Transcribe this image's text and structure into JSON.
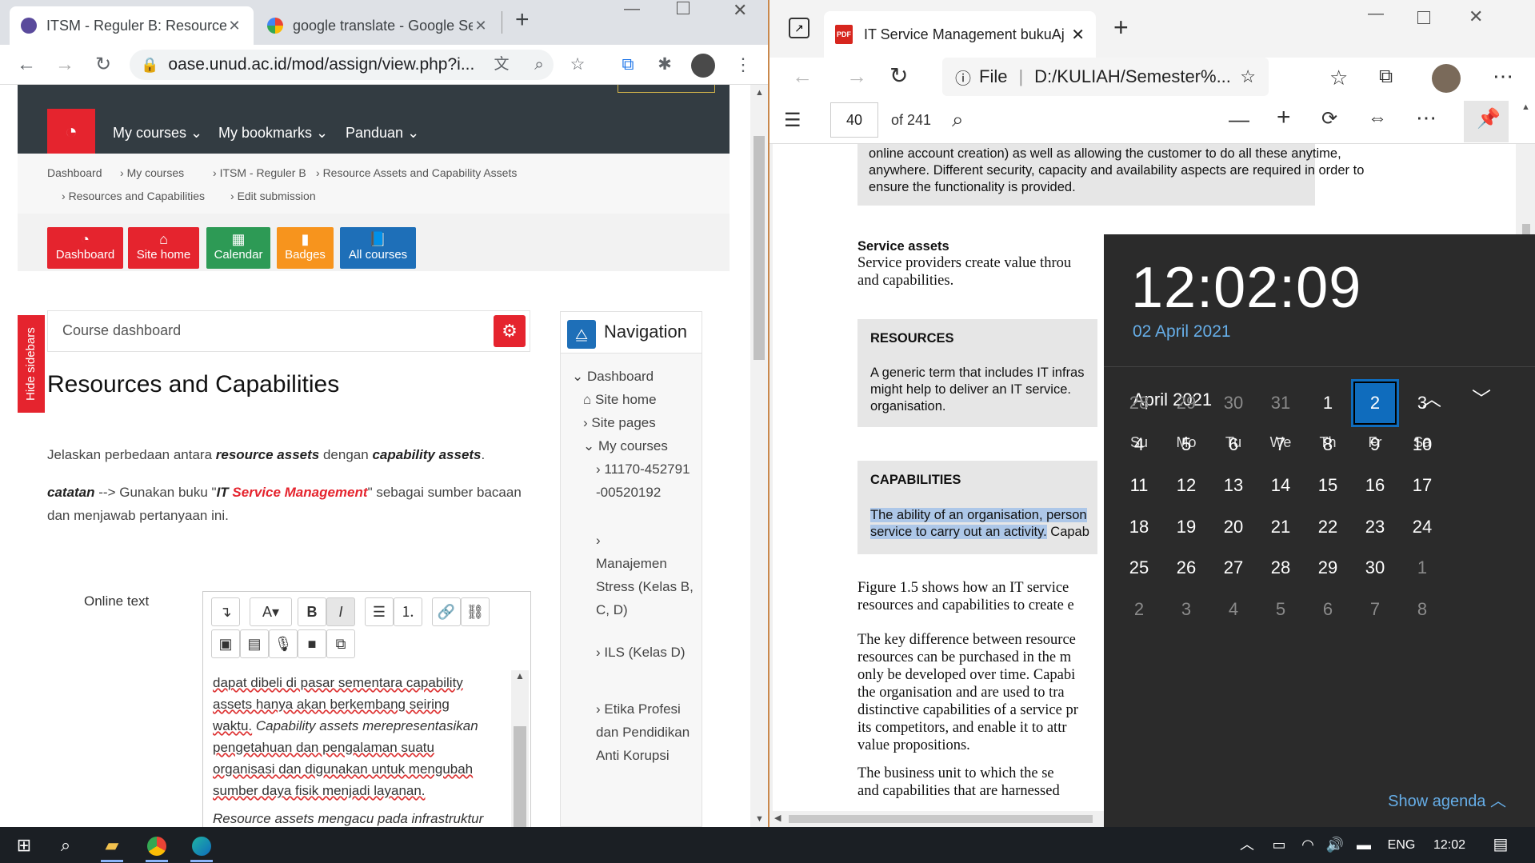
{
  "chrome": {
    "tabs": [
      {
        "title": "ITSM - Reguler B: Resources and",
        "active": true
      },
      {
        "title": "google translate - Google Searc",
        "active": false
      }
    ],
    "url": "oase.unud.ac.id/mod/assign/view.php?i...",
    "navbar": {
      "my_courses": "My courses",
      "my_bookmarks": "My bookmarks",
      "panduan": "Panduan"
    },
    "breadcrumb": [
      "Dashboard",
      "My courses",
      "ITSM - Reguler B",
      "Resource Assets and Capability Assets",
      "Resources and Capabilities",
      "Edit submission"
    ],
    "quick_buttons": [
      {
        "label": "Dashboard",
        "color": "#e5242e"
      },
      {
        "label": "Site home",
        "color": "#e5242e"
      },
      {
        "label": "Calendar",
        "color": "#2d9a55"
      },
      {
        "label": "Badges",
        "color": "#f7941d"
      },
      {
        "label": "All courses",
        "color": "#1e6fb8"
      }
    ],
    "hide_sidebars": "Hide sidebars",
    "course_dashboard": "Course dashboard",
    "page_title": "Resources and Capabilities",
    "question": {
      "p1_a": "Jelaskan perbedaan antara ",
      "p1_b": "resource assets",
      "p1_c": " dengan ",
      "p1_d": "capability assets",
      "p1_e": ".",
      "p2_a": "catatan",
      "p2_b": " --> Gunakan buku \"",
      "p2_c": "IT ",
      "p2_d": "Service Management",
      "p2_e": "\" sebagai sumber bacaan dan menjawab pertanyaan ini."
    },
    "online_text_label": "Online text",
    "editor_text": {
      "l1": "dapat dibeli di pasar sementara capability",
      "l2": "assets hanya akan berkembang seiring",
      "l3a": "waktu.",
      "l3b": " Capability assets merepresentasikan",
      "l4": "pengetahuan dan pengalaman suatu",
      "l5": "organisasi dan digunakan untuk mengubah",
      "l6": "sumber daya fisik menjadi layanan.",
      "l7": "Resource assets mengacu pada infrastruktur"
    },
    "navigation": {
      "title": "Navigation",
      "items": [
        "Dashboard",
        "Site home",
        "Site pages",
        "My courses"
      ],
      "courses": [
        "11170-452791-00520192",
        "Manajemen Stress (Kelas B, C, D)",
        "ILS (Kelas D)",
        "Etika Profesi dan Pendidikan Anti Korupsi"
      ]
    }
  },
  "edge": {
    "tab_title": "IT Service Management bukuAjar",
    "file_label": "File",
    "url": "D:/KULIAH/Semester%...",
    "pdf": {
      "page": "40",
      "of_pages": "of 241",
      "block1": [
        "online account creation) as well as allowing the customer to do all these anytime,",
        "anywhere. Different security, capacity and availability aspects are required in order to",
        "ensure the functionality is provided."
      ],
      "service_assets_heading": "Service assets",
      "service_assets_text": [
        "Service providers create value throu",
        "and capabilities."
      ],
      "resources_heading": "RESOURCES",
      "resources_text": [
        "A generic term that includes IT infras",
        "might help to deliver an IT service.",
        "organisation."
      ],
      "capabilities_heading": "CAPABILITIES",
      "capabilities_text": [
        "The ability of an organisation, person",
        "service to carry out an activity.",
        " Capab"
      ],
      "figure_text": [
        "Figure 1.5 shows how an IT service",
        "resources and capabilities to create e"
      ],
      "key_text": [
        "The key difference between resource",
        "resources can be purchased in the m",
        "only be developed over time. Capabi",
        "the organisation and are used to tra",
        "distinctive capabilities of a service pr",
        "its competitors, and enable it to attr",
        "value propositions."
      ],
      "business_text": [
        "The business unit to which the se",
        "and capabilities that are harnessed"
      ]
    }
  },
  "calendar": {
    "time": "12:02:09",
    "date": "02 April 2021",
    "month": "April 2021",
    "weekdays": [
      "Su",
      "Mo",
      "Tu",
      "We",
      "Th",
      "Fr",
      "Sa"
    ],
    "days": [
      [
        "28",
        "29",
        "30",
        "31",
        "1",
        "2",
        "3"
      ],
      [
        "4",
        "5",
        "6",
        "7",
        "8",
        "9",
        "10"
      ],
      [
        "11",
        "12",
        "13",
        "14",
        "15",
        "16",
        "17"
      ],
      [
        "18",
        "19",
        "20",
        "21",
        "22",
        "23",
        "24"
      ],
      [
        "25",
        "26",
        "27",
        "28",
        "29",
        "30",
        "1"
      ],
      [
        "2",
        "3",
        "4",
        "5",
        "6",
        "7",
        "8"
      ]
    ],
    "selected_day": "2",
    "show_agenda": "Show agenda"
  },
  "taskbar": {
    "language": "ENG",
    "clock": "12:02"
  }
}
